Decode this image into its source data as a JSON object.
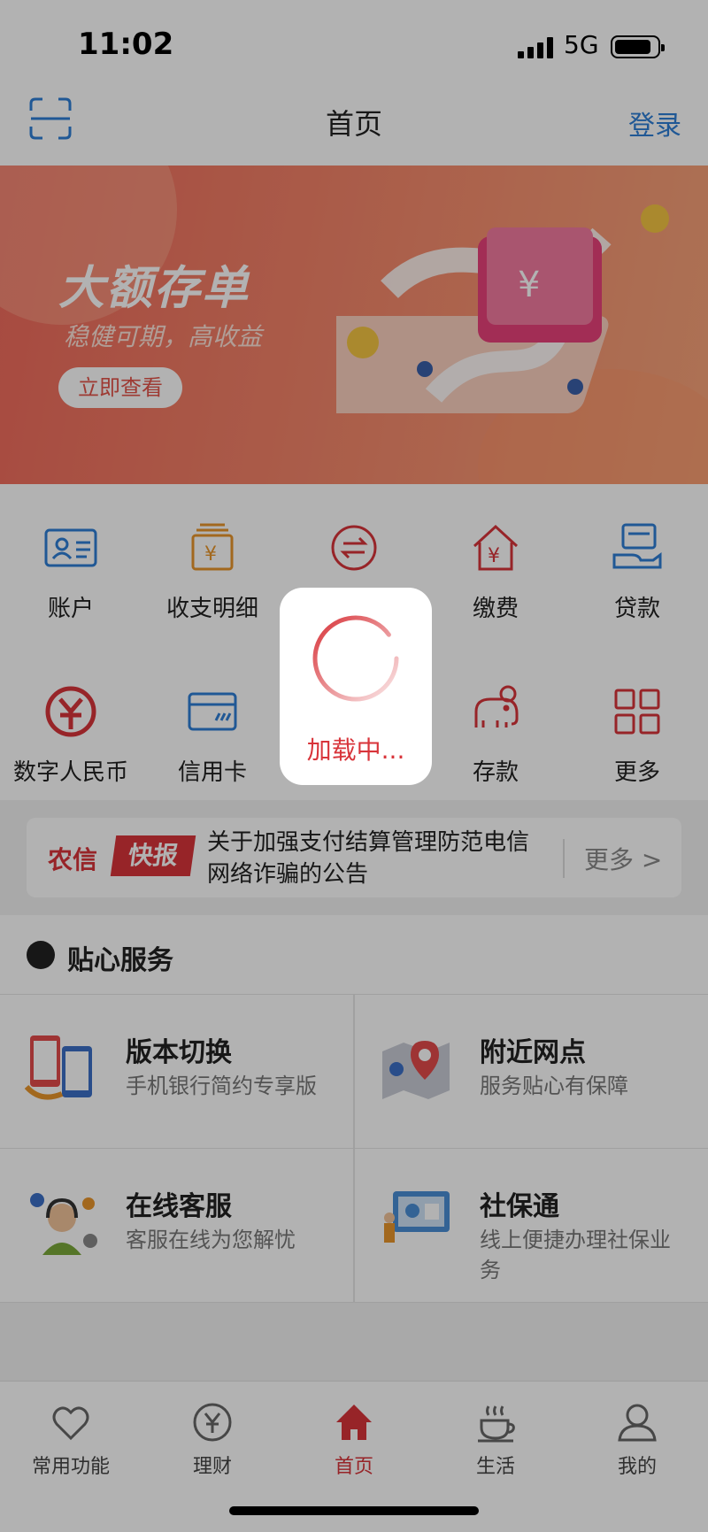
{
  "status_bar": {
    "time": "11:02",
    "network": "5G"
  },
  "navbar": {
    "title": "首页",
    "login": "登录"
  },
  "banner": {
    "headline": "大额存单",
    "subtitle": "稳健可期，高收益",
    "cta": "立即查看"
  },
  "grid": {
    "items": [
      {
        "label": "账户",
        "icon": "id-card-icon"
      },
      {
        "label": "收支明细",
        "icon": "ledger-icon"
      },
      {
        "label": "",
        "icon": "transfer-icon"
      },
      {
        "label": "缴费",
        "icon": "house-yen-icon"
      },
      {
        "label": "贷款",
        "icon": "loan-icon"
      },
      {
        "label": "数字人民币",
        "icon": "digital-rmb-icon"
      },
      {
        "label": "信用卡",
        "icon": "credit-card-icon"
      },
      {
        "label": "",
        "icon": ""
      },
      {
        "label": "存款",
        "icon": "elephant-icon"
      },
      {
        "label": "更多",
        "icon": "grid-icon"
      }
    ],
    "colors": {
      "blue": "#2f7fd6",
      "orange": "#e9962b",
      "red": "#d8343a"
    }
  },
  "news": {
    "logo_left": "农信",
    "logo_right": "快报",
    "text": "关于加强支付结算管理防范电信网络诈骗的公告",
    "more": "更多 >"
  },
  "services": {
    "title": "贴心服务",
    "items": [
      {
        "title": "版本切换",
        "desc": "手机银行简约专享版"
      },
      {
        "title": "附近网点",
        "desc": "服务贴心有保障"
      },
      {
        "title": "在线客服",
        "desc": "客服在线为您解忧"
      },
      {
        "title": "社保通",
        "desc": "线上便捷办理社保业务"
      }
    ]
  },
  "tabbar": {
    "items": [
      {
        "label": "常用功能",
        "icon": "heart-icon"
      },
      {
        "label": "理财",
        "icon": "yen-circle-icon"
      },
      {
        "label": "首页",
        "icon": "home-icon"
      },
      {
        "label": "生活",
        "icon": "coffee-icon"
      },
      {
        "label": "我的",
        "icon": "person-icon"
      }
    ],
    "active_color": "#d8343a"
  },
  "loading": {
    "text": "加载中..."
  }
}
